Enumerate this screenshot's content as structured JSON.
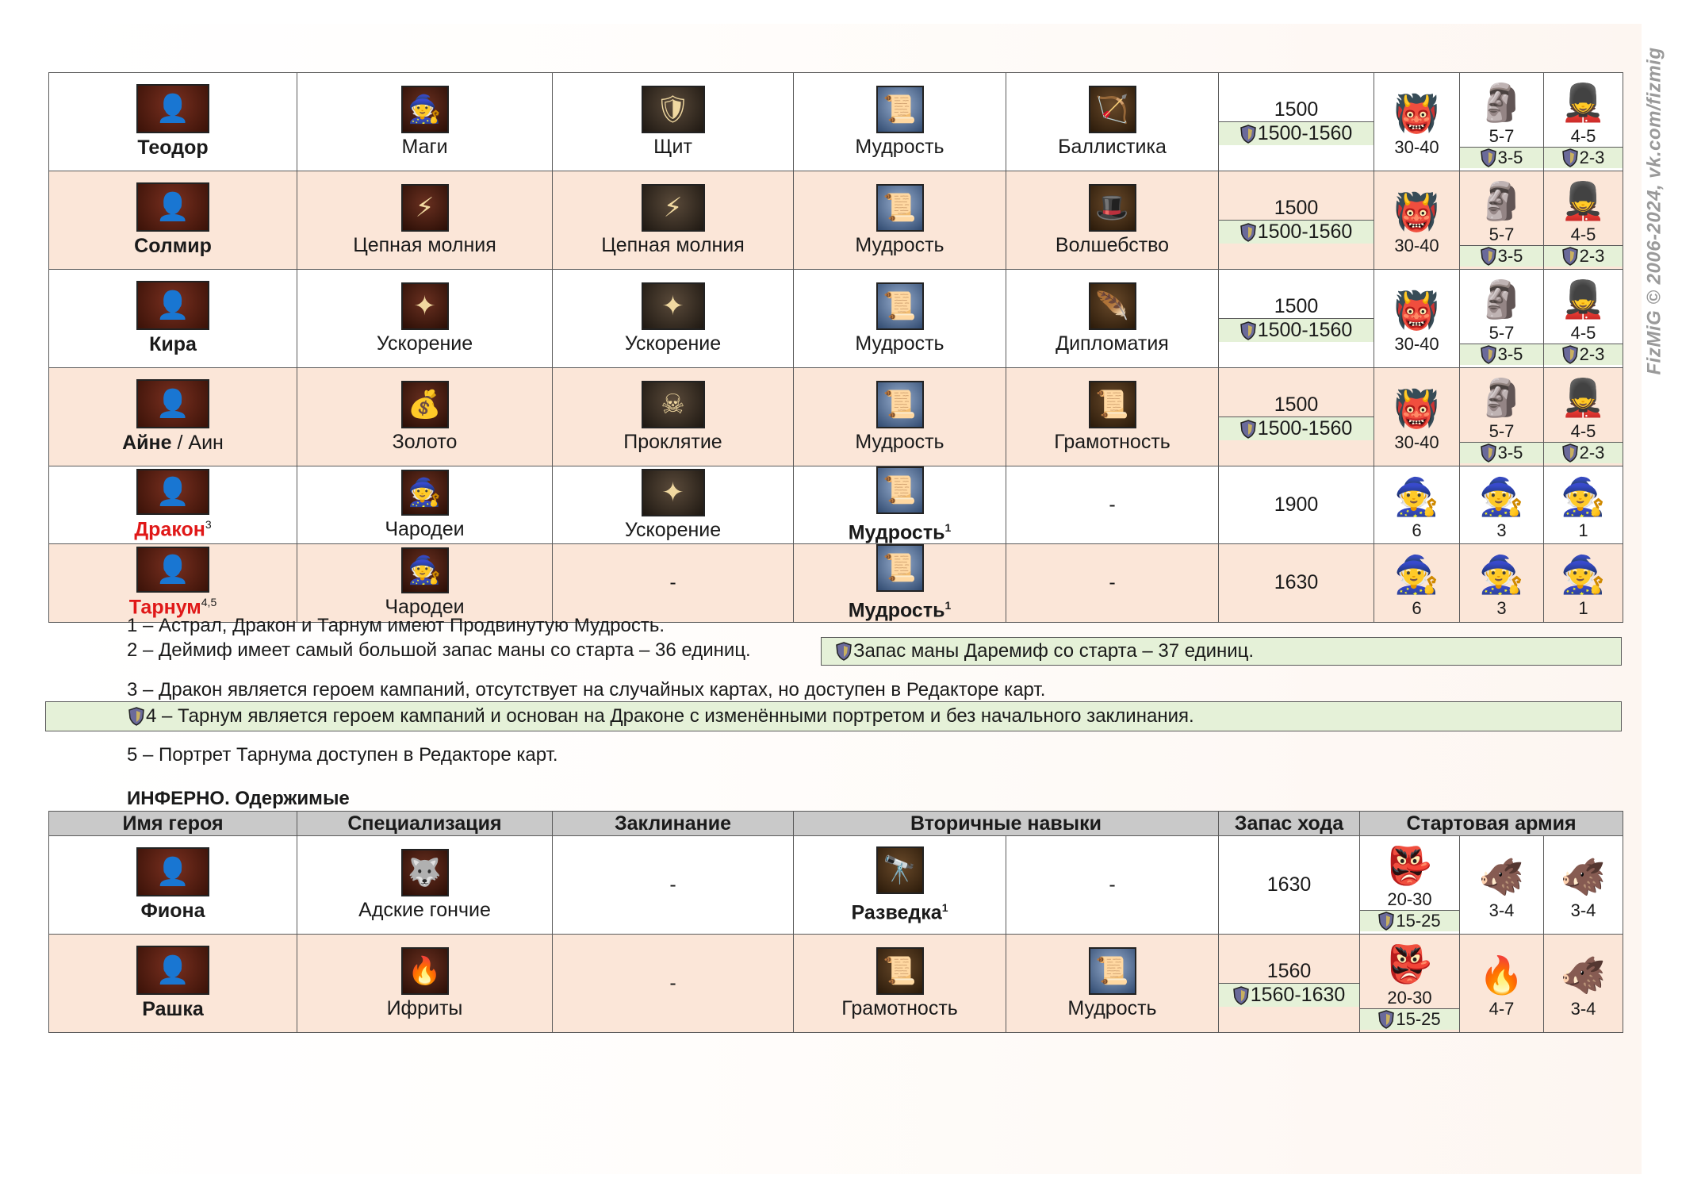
{
  "watermark": "FizMiG © 2006-2024, vk.com/fizmig",
  "table1": {
    "rows": [
      {
        "hero": "Теодор",
        "hero_color": "#1a1a1a",
        "spec": "Маги",
        "spell": "Щит",
        "skill1": "Мудрость",
        "skill2": "Баллистика",
        "moves": "1500",
        "moves_alt": "1500-1560",
        "army": [
          {
            "count": "30-40",
            "alt": ""
          },
          {
            "count": "5-7",
            "alt": "3-5"
          },
          {
            "count": "4-5",
            "alt": "2-3"
          }
        ]
      },
      {
        "hero": "Солмир",
        "hero_color": "#1a1a1a",
        "spec": "Цепная молния",
        "spell": "Цепная молния",
        "skill1": "Мудрость",
        "skill2": "Волшебство",
        "moves": "1500",
        "moves_alt": "1500-1560",
        "army": [
          {
            "count": "30-40",
            "alt": ""
          },
          {
            "count": "5-7",
            "alt": "3-5"
          },
          {
            "count": "4-5",
            "alt": "2-3"
          }
        ]
      },
      {
        "hero": "Кира",
        "hero_color": "#1a1a1a",
        "spec": "Ускорение",
        "spell": "Ускорение",
        "skill1": "Мудрость",
        "skill2": "Дипломатия",
        "moves": "1500",
        "moves_alt": "1500-1560",
        "army": [
          {
            "count": "30-40",
            "alt": ""
          },
          {
            "count": "5-7",
            "alt": "3-5"
          },
          {
            "count": "4-5",
            "alt": "2-3"
          }
        ]
      },
      {
        "hero": "Айне",
        "hero_suffix": " / Аин",
        "hero_color": "#1a1a1a",
        "spec": "Золото",
        "spell": "Проклятие",
        "skill1": "Мудрость",
        "skill2": "Грамотность",
        "moves": "1500",
        "moves_alt": "1500-1560",
        "army": [
          {
            "count": "30-40",
            "alt": ""
          },
          {
            "count": "5-7",
            "alt": "3-5"
          },
          {
            "count": "4-5",
            "alt": "2-3"
          }
        ]
      },
      {
        "hero": "Дракон",
        "hero_sup": "3",
        "hero_color": "#e01818",
        "spec": "Чародеи",
        "spell": "Ускорение",
        "skill1": "Мудрость",
        "skill1_sup": "1",
        "skill2": "-",
        "moves": "1900",
        "moves_alt": "",
        "army": [
          {
            "count": "6",
            "alt": ""
          },
          {
            "count": "3",
            "alt": ""
          },
          {
            "count": "1",
            "alt": ""
          }
        ]
      },
      {
        "hero": "Тарнум",
        "hero_sup": "4,5",
        "hero_color": "#e01818",
        "spec": "Чародеи",
        "spell": "-",
        "skill1": "Мудрость",
        "skill1_sup": "1",
        "skill2": "-",
        "moves": "1630",
        "moves_alt": "",
        "army": [
          {
            "count": "6",
            "alt": ""
          },
          {
            "count": "3",
            "alt": ""
          },
          {
            "count": "1",
            "alt": ""
          }
        ]
      }
    ]
  },
  "notes": {
    "n1": "1 – Астрал, Дракон и Тарнум имеют Продвинутую Мудрость.",
    "n2": "2 – Деймиф имеет самый большой запас маны со старта – 36 единиц.",
    "n2_box": "Запас маны Даремиф со старта – 37 единиц.",
    "n3": "3 – Дракон является героем кампаний, отсутствует на случайных картах, но доступен в Редакторе карт.",
    "n4_box": "4 – Тарнум является героем кампаний и основан на Драконе с изменёнными портретом и без начального заклинания.",
    "n5": "5 – Портрет Тарнума доступен в Редакторе карт."
  },
  "section2": {
    "title": "ИНФЕРНО. Одержимые",
    "headers": [
      "Имя героя",
      "Специализация",
      "Заклинание",
      "Вторичные навыки",
      "Запас хода",
      "Стартовая армия"
    ],
    "rows": [
      {
        "hero": "Фиона",
        "spec": "Адские гончие",
        "spell": "-",
        "skill1": "Разведка",
        "skill1_sup": "1",
        "skill2": "-",
        "moves": "1630",
        "moves_alt": "",
        "army": [
          {
            "count": "20-30",
            "alt": "15-25"
          },
          {
            "count": "3-4",
            "alt": ""
          },
          {
            "count": "3-4",
            "alt": ""
          }
        ]
      },
      {
        "hero": "Рашка",
        "spec": "Ифриты",
        "spell": "-",
        "skill1": "Грамотность",
        "skill2": "Мудрость",
        "moves": "1560",
        "moves_alt": "1560-1630",
        "army": [
          {
            "count": "20-30",
            "alt": "15-25"
          },
          {
            "count": "4-7",
            "alt": ""
          },
          {
            "count": "3-4",
            "alt": ""
          }
        ]
      }
    ]
  },
  "colors": {
    "row_alt": "#fbe6d8",
    "green_box": "#e5f1d8",
    "header": "#c9c9c9",
    "red_name": "#e01818"
  }
}
